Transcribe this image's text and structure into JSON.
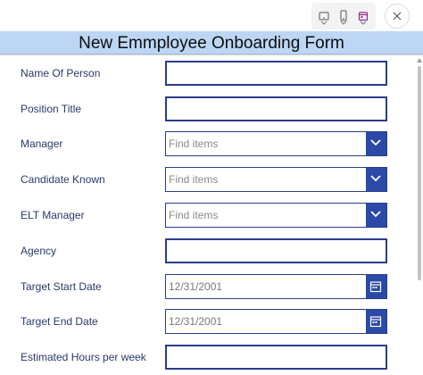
{
  "toolbar": {
    "devices": [
      "tablet-icon",
      "phone-icon",
      "calendar-view-icon"
    ],
    "close": "close-icon"
  },
  "form": {
    "title": "New Emmployee Onboarding Form",
    "fields": [
      {
        "label": "Name Of Person",
        "type": "text",
        "value": ""
      },
      {
        "label": "Position Title",
        "type": "text",
        "value": ""
      },
      {
        "label": "Manager",
        "type": "combo",
        "placeholder": "Find items"
      },
      {
        "label": "Candidate Known",
        "type": "combo",
        "placeholder": "Find items"
      },
      {
        "label": "ELT Manager",
        "type": "combo",
        "placeholder": "Find items"
      },
      {
        "label": "Agency",
        "type": "text",
        "value": ""
      },
      {
        "label": "Target Start Date",
        "type": "date",
        "value": "12/31/2001"
      },
      {
        "label": "Target End Date",
        "type": "date",
        "value": "12/31/2001"
      },
      {
        "label": "Estimated Hours per week",
        "type": "text",
        "value": ""
      }
    ]
  },
  "colors": {
    "header_bg": "#bcd6f3",
    "field_border": "#2b3d8a",
    "button_bg": "#2b4aa8"
  }
}
